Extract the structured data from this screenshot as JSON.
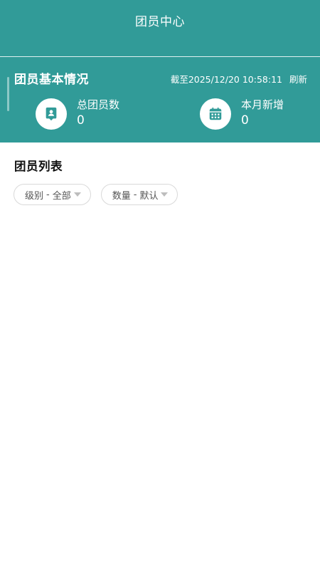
{
  "header": {
    "title": "团员中心"
  },
  "summary": {
    "title": "团员基本情况",
    "timestamp": "截至2025/12/20 10:58:11",
    "refresh_label": "刷新",
    "stats": [
      {
        "label": "总团员数",
        "value": "0",
        "icon": "member-badge-icon"
      },
      {
        "label": "本月新增",
        "value": "0",
        "icon": "calendar-icon"
      }
    ]
  },
  "list": {
    "title": "团员列表",
    "filters": [
      {
        "label": "级别",
        "value": "全部"
      },
      {
        "label": "数量",
        "value": "默认"
      }
    ]
  },
  "colors": {
    "accent": "#319b98",
    "white": "#ffffff"
  }
}
